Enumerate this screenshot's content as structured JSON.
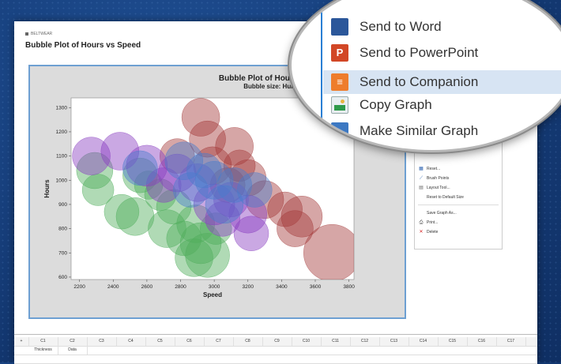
{
  "app": {
    "title_bar_text": "BELTWEAR",
    "document_title": "Bubble Plot of Hours vs Speed"
  },
  "chart_data": {
    "type": "scatter",
    "title": "Bubble Plot of Hours vs Speed",
    "subtitle": "Bubble size: Humidity",
    "xlabel": "Speed",
    "ylabel": "Hours",
    "xlim": [
      2150,
      3830
    ],
    "ylim": [
      590,
      1340
    ],
    "xticks": [
      2200,
      2400,
      2600,
      2800,
      3000,
      3200,
      3400,
      3600,
      3800
    ],
    "yticks": [
      600,
      700,
      800,
      900,
      1000,
      1100,
      1200,
      1300
    ],
    "grid": false,
    "series": [
      {
        "color": "#4fae5c",
        "points": [
          {
            "x": 2290,
            "y": 1040,
            "r": 23
          },
          {
            "x": 2310,
            "y": 960,
            "r": 20
          },
          {
            "x": 2450,
            "y": 870,
            "r": 22
          },
          {
            "x": 2530,
            "y": 850,
            "r": 24
          },
          {
            "x": 2610,
            "y": 980,
            "r": 18
          },
          {
            "x": 2720,
            "y": 800,
            "r": 24
          },
          {
            "x": 2820,
            "y": 760,
            "r": 22
          },
          {
            "x": 2920,
            "y": 740,
            "r": 26
          },
          {
            "x": 2960,
            "y": 690,
            "r": 28
          },
          {
            "x": 2880,
            "y": 680,
            "r": 24
          },
          {
            "x": 3010,
            "y": 800,
            "r": 20
          },
          {
            "x": 2760,
            "y": 890,
            "r": 22
          },
          {
            "x": 2680,
            "y": 940,
            "r": 20
          },
          {
            "x": 2560,
            "y": 1020,
            "r": 22
          },
          {
            "x": 2890,
            "y": 820,
            "r": 24
          }
        ]
      },
      {
        "color": "#a33a3a",
        "points": [
          {
            "x": 2920,
            "y": 1260,
            "r": 24
          },
          {
            "x": 2960,
            "y": 1170,
            "r": 23
          },
          {
            "x": 3120,
            "y": 1140,
            "r": 24
          },
          {
            "x": 3200,
            "y": 1010,
            "r": 23
          },
          {
            "x": 3300,
            "y": 920,
            "r": 24
          },
          {
            "x": 3420,
            "y": 880,
            "r": 22
          },
          {
            "x": 3520,
            "y": 850,
            "r": 26
          },
          {
            "x": 3480,
            "y": 800,
            "r": 23
          },
          {
            "x": 3700,
            "y": 700,
            "r": 36
          },
          {
            "x": 3080,
            "y": 980,
            "r": 22
          },
          {
            "x": 3150,
            "y": 1060,
            "r": 20
          },
          {
            "x": 2780,
            "y": 1100,
            "r": 22
          },
          {
            "x": 2990,
            "y": 1060,
            "r": 24
          }
        ]
      },
      {
        "color": "#8a3fc0",
        "points": [
          {
            "x": 2270,
            "y": 1100,
            "r": 24
          },
          {
            "x": 2440,
            "y": 1120,
            "r": 24
          },
          {
            "x": 2600,
            "y": 1060,
            "r": 26
          },
          {
            "x": 2780,
            "y": 1030,
            "r": 24
          },
          {
            "x": 2900,
            "y": 990,
            "r": 24
          },
          {
            "x": 3000,
            "y": 900,
            "r": 26
          },
          {
            "x": 3100,
            "y": 920,
            "r": 22
          },
          {
            "x": 3200,
            "y": 860,
            "r": 24
          },
          {
            "x": 3220,
            "y": 780,
            "r": 22
          },
          {
            "x": 3050,
            "y": 840,
            "r": 22
          },
          {
            "x": 2700,
            "y": 980,
            "r": 22
          }
        ]
      },
      {
        "color": "#4a7ccc",
        "points": [
          {
            "x": 2560,
            "y": 1050,
            "r": 22
          },
          {
            "x": 2820,
            "y": 1080,
            "r": 24
          },
          {
            "x": 2940,
            "y": 1040,
            "r": 22
          },
          {
            "x": 3000,
            "y": 1000,
            "r": 24
          },
          {
            "x": 3120,
            "y": 980,
            "r": 22
          },
          {
            "x": 3240,
            "y": 960,
            "r": 22
          },
          {
            "x": 3060,
            "y": 900,
            "r": 24
          },
          {
            "x": 2860,
            "y": 960,
            "r": 22
          }
        ]
      }
    ]
  },
  "context_menu": {
    "items": [
      {
        "label": "Reset...",
        "icon": "reset-icon"
      },
      {
        "label": "Brush Points",
        "icon": "brush-icon"
      },
      {
        "label": "Layout Tool...",
        "icon": "layout-icon"
      },
      {
        "label": "Reset to Default Size",
        "icon": ""
      },
      {
        "label": "Save Graph As...",
        "icon": ""
      },
      {
        "label": "Print...",
        "icon": "print-icon"
      },
      {
        "label": "Delete",
        "icon": "delete-icon"
      }
    ]
  },
  "magnifier_menu": {
    "items": [
      {
        "label": "Send to Word",
        "icon": "word-icon"
      },
      {
        "label": "Send to PowerPoint",
        "icon": "powerpoint-icon"
      },
      {
        "label": "Send to Companion",
        "icon": "companion-icon"
      },
      {
        "label": "Copy Graph",
        "icon": "copy-graph-icon"
      },
      {
        "label": "Make Similar Graph",
        "icon": "make-similar-graph-icon"
      }
    ],
    "highlighted": "Send to Companion",
    "accent": "#2a7fd4"
  },
  "worksheet": {
    "columns": [
      "C1",
      "C2",
      "C3",
      "C4",
      "C5",
      "C6",
      "C7",
      "C8",
      "C9",
      "C10",
      "C11",
      "C12",
      "C13",
      "C14",
      "C15",
      "C16",
      "C17"
    ],
    "names": [
      "Thickness",
      "Data"
    ]
  }
}
